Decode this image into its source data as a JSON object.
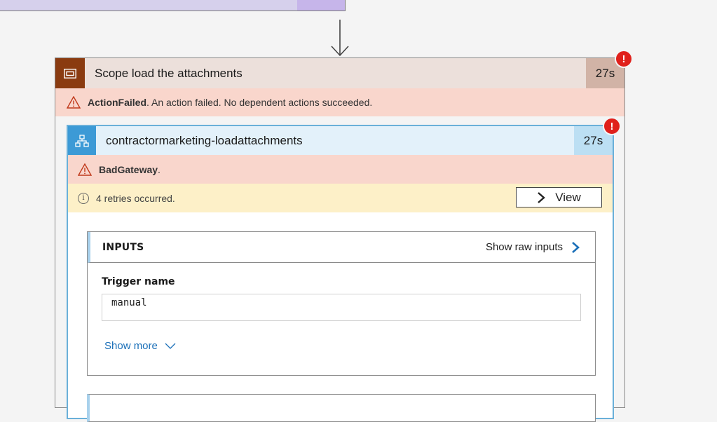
{
  "scope": {
    "title": "Scope load the attachments",
    "duration": "27s",
    "error_code": "ActionFailed",
    "error_message": ". An action failed. No dependent actions succeeded.",
    "badge": "!"
  },
  "action": {
    "title": "contractormarketing-loadattachments",
    "duration": "27s",
    "error_code": "BadGateway",
    "error_suffix": ".",
    "badge": "!",
    "retries_text": "4 retries occurred.",
    "view_label": "View"
  },
  "inputs": {
    "heading": "INPUTS",
    "raw_link": "Show raw inputs",
    "field_label": "Trigger name",
    "field_value": "manual",
    "show_more": "Show more"
  },
  "icons": {
    "scope": "scope-icon",
    "action": "workflow-icon",
    "warning": "warning-icon",
    "info": "info-icon"
  },
  "colors": {
    "scope_accent": "#8a3b10",
    "action_accent": "#3c9ad6",
    "error_bg": "#f9d6cc",
    "retry_bg": "#fdf0c8",
    "link": "#1a6fb8",
    "badge": "#e0201b"
  }
}
